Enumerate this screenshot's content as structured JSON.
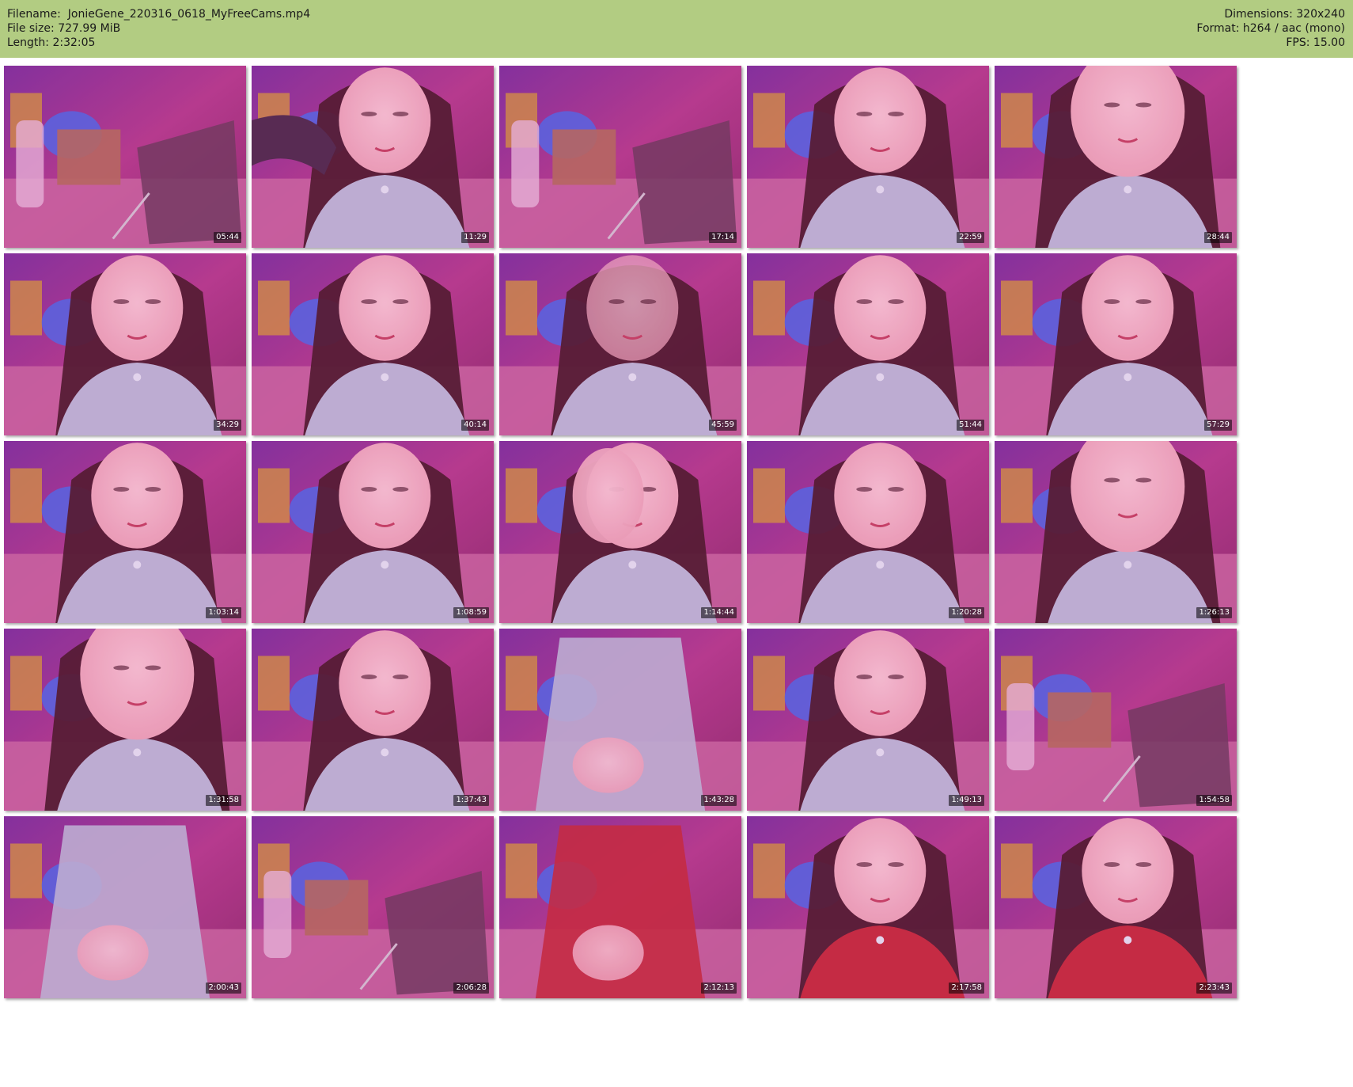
{
  "header": {
    "filename_label": "Filename:",
    "filename": "JonieGene_220316_0618_MyFreeCams.mp4",
    "filesize_label": "File size:",
    "filesize": "727.99 MiB",
    "length_label": "Length:",
    "length": "2:32:05",
    "dimensions_label": "Dimensions:",
    "dimensions": "320x240",
    "format_label": "Format:",
    "format": "h264 / aac (mono)",
    "fps_label": "FPS:",
    "fps": "15.00"
  },
  "colors": {
    "header_bg": "#b2cc82",
    "room_purple": "#7a2f9a",
    "wall_magenta": "#b03a8a",
    "floor_pink": "#c86aa0",
    "light_blue": "#3f6ff0",
    "skin": "#e8a0b4",
    "hair": "#4a1a2a",
    "top_grey": "#b8b6d4",
    "red_top": "#c02a3a"
  },
  "thumbnails": [
    {
      "time": "05:44",
      "scene": "room-chair"
    },
    {
      "time": "11:29",
      "scene": "person-arm"
    },
    {
      "time": "17:14",
      "scene": "room-chair"
    },
    {
      "time": "22:59",
      "scene": "person"
    },
    {
      "time": "28:44",
      "scene": "person-close"
    },
    {
      "time": "34:29",
      "scene": "person"
    },
    {
      "time": "40:14",
      "scene": "person"
    },
    {
      "time": "45:59",
      "scene": "person-blur"
    },
    {
      "time": "51:44",
      "scene": "person"
    },
    {
      "time": "57:29",
      "scene": "person"
    },
    {
      "time": "1:03:14",
      "scene": "person"
    },
    {
      "time": "1:08:59",
      "scene": "person"
    },
    {
      "time": "1:14:44",
      "scene": "person-hand"
    },
    {
      "time": "1:20:28",
      "scene": "person"
    },
    {
      "time": "1:26:13",
      "scene": "person-close"
    },
    {
      "time": "1:31:58",
      "scene": "person-close"
    },
    {
      "time": "1:37:43",
      "scene": "person"
    },
    {
      "time": "1:43:28",
      "scene": "torso"
    },
    {
      "time": "1:49:13",
      "scene": "person"
    },
    {
      "time": "1:54:58",
      "scene": "room-chair"
    },
    {
      "time": "2:00:43",
      "scene": "torso-low"
    },
    {
      "time": "2:06:28",
      "scene": "room-chair"
    },
    {
      "time": "2:12:13",
      "scene": "torso-red"
    },
    {
      "time": "2:17:58",
      "scene": "person-red"
    },
    {
      "time": "2:23:43",
      "scene": "person-red"
    }
  ]
}
